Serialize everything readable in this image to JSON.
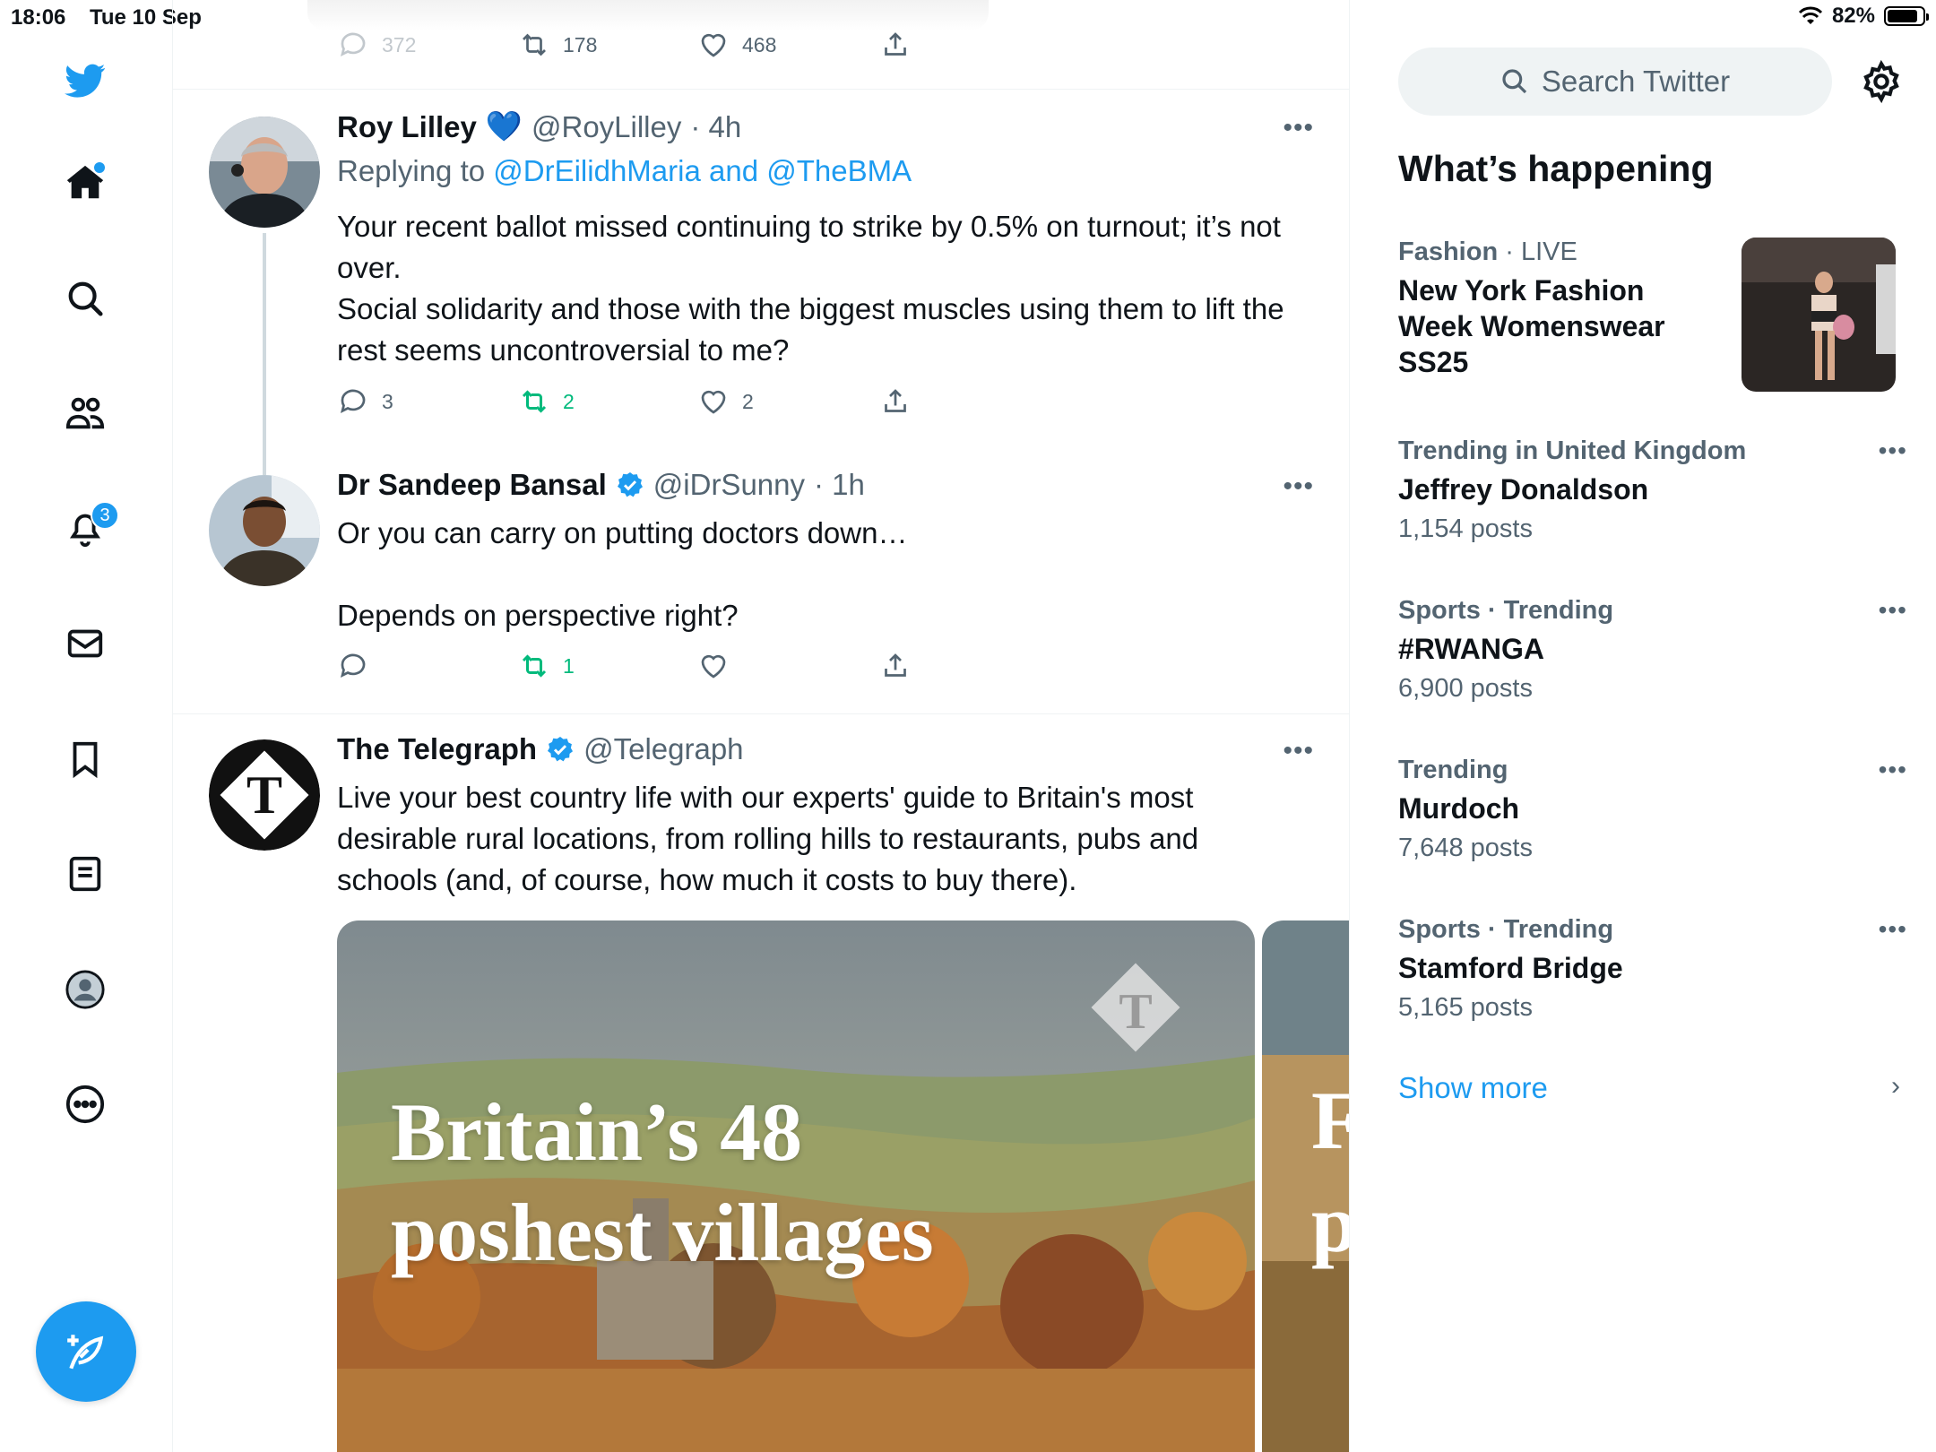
{
  "status": {
    "time": "18:06",
    "date": "Tue 10 Sep",
    "battery": "82%"
  },
  "nav": {
    "notifications_badge": "3"
  },
  "top_tweet_actions": {
    "replies": "372",
    "retweets": "178",
    "likes": "468"
  },
  "tweets": [
    {
      "name": "Roy Lilley",
      "emoji": "💙",
      "handle": "@RoyLilley",
      "time": "· 4h",
      "replying_prefix": "Replying to ",
      "replying_to": "@DrEilidhMaria and @TheBMA",
      "text": "Your recent ballot missed continuing to strike by 0.5% on turnout; it’s not over.\nSocial solidarity and those with the biggest muscles using them to lift the rest seems uncontroversial to me?",
      "replies": "3",
      "retweets": "2",
      "likes": "2"
    },
    {
      "name": "Dr Sandeep Bansal",
      "handle": "@iDrSunny",
      "time": "· 1h",
      "text": "Or you can carry on putting doctors down…\n\nDepends on perspective right?",
      "replies": "",
      "retweets": "1",
      "likes": ""
    },
    {
      "name": "The Telegraph",
      "handle": "@Telegraph",
      "text": "Live your best country life with our experts' guide to Britain's most desirable rural locations, from rolling hills to restaurants, pubs and schools (and, of course, how much it costs to buy there).",
      "media_title_line1": "Britain’s 48",
      "media_title_line2": "poshest villages",
      "media2_line1": "F",
      "media2_line2": "p"
    }
  ],
  "sidebar": {
    "search_placeholder": "Search Twitter",
    "section_title": "What’s happening",
    "trends": [
      {
        "category": "Fashion",
        "suffix": " · LIVE",
        "name": "New York Fashion Week Womenswear SS25",
        "count": ""
      },
      {
        "category": "Trending in United Kingdom",
        "suffix": "",
        "name": "Jeffrey Donaldson",
        "count": "1,154 posts"
      },
      {
        "category": "Sports · Trending",
        "suffix": "",
        "name": "#RWANGA",
        "count": "6,900 posts"
      },
      {
        "category": "Trending",
        "suffix": "",
        "name": "Murdoch",
        "count": "7,648 posts"
      },
      {
        "category": "Sports · Trending",
        "suffix": "",
        "name": "Stamford Bridge",
        "count": "5,165 posts"
      }
    ],
    "show_more": "Show more"
  },
  "colors": {
    "accent": "#1d9bf0",
    "retweet_green": "#00ba7c",
    "secondary_text": "#536471",
    "text": "#0f1419"
  }
}
